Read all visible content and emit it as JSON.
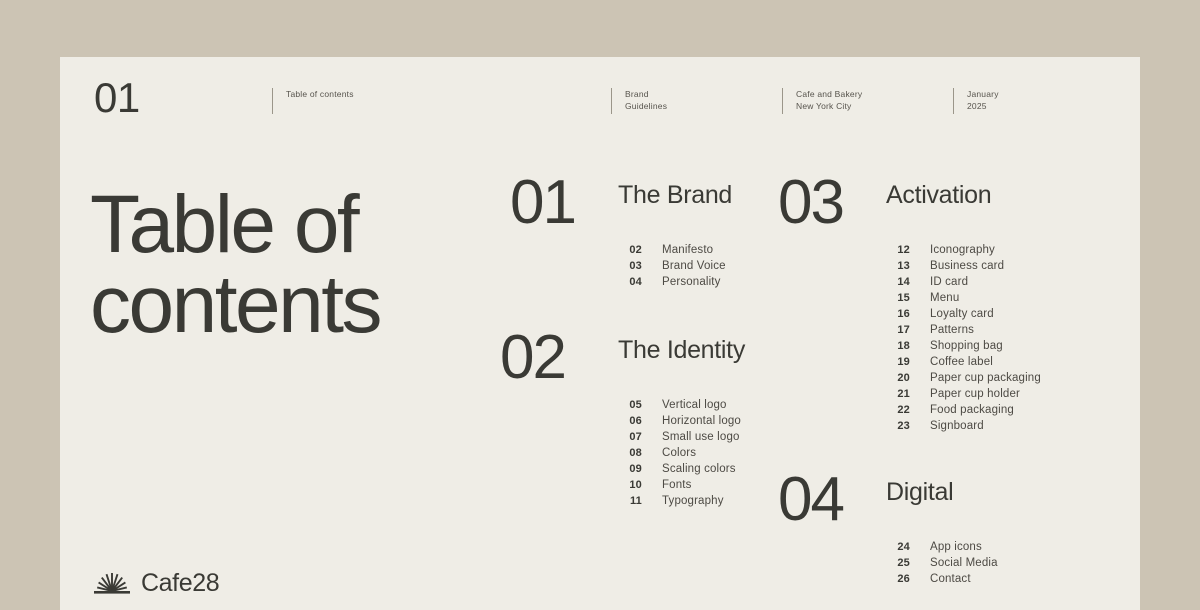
{
  "colors": {
    "outer_background": "#ccc4b4",
    "page_background": "#efede6",
    "ink": "#3a3a35",
    "muted_ink": "#57544d",
    "rule": "#9b968a"
  },
  "header": {
    "page_number": "01",
    "label": "Table of contents",
    "meta": [
      {
        "line1": "Brand",
        "line2": "Guidelines"
      },
      {
        "line1": "Cafe and Bakery",
        "line2": "New York City"
      },
      {
        "line1": "January",
        "line2": "2025"
      }
    ]
  },
  "title": "Table of contents",
  "sections": [
    {
      "number": "01",
      "title": "The Brand",
      "items": [
        {
          "num": "02",
          "label": "Manifesto"
        },
        {
          "num": "03",
          "label": "Brand Voice"
        },
        {
          "num": "04",
          "label": "Personality"
        }
      ]
    },
    {
      "number": "02",
      "title": "The Identity",
      "items": [
        {
          "num": "05",
          "label": "Vertical logo"
        },
        {
          "num": "06",
          "label": "Horizontal logo"
        },
        {
          "num": "07",
          "label": "Small use logo"
        },
        {
          "num": "08",
          "label": "Colors"
        },
        {
          "num": "09",
          "label": "Scaling colors"
        },
        {
          "num": "10",
          "label": "Fonts"
        },
        {
          "num": "11",
          "label": "Typography"
        }
      ]
    },
    {
      "number": "03",
      "title": "Activation",
      "items": [
        {
          "num": "12",
          "label": "Iconography"
        },
        {
          "num": "13",
          "label": "Business card"
        },
        {
          "num": "14",
          "label": "ID card"
        },
        {
          "num": "15",
          "label": "Menu"
        },
        {
          "num": "16",
          "label": "Loyalty card"
        },
        {
          "num": "17",
          "label": "Patterns"
        },
        {
          "num": "18",
          "label": "Shopping bag"
        },
        {
          "num": "19",
          "label": "Coffee label"
        },
        {
          "num": "20",
          "label": "Paper cup packaging"
        },
        {
          "num": "21",
          "label": "Paper cup holder"
        },
        {
          "num": "22",
          "label": "Food packaging"
        },
        {
          "num": "23",
          "label": "Signboard"
        }
      ]
    },
    {
      "number": "04",
      "title": "Digital",
      "items": [
        {
          "num": "24",
          "label": "App icons"
        },
        {
          "num": "25",
          "label": "Social Media"
        },
        {
          "num": "26",
          "label": "Contact"
        }
      ]
    }
  ],
  "footer": {
    "brand_name": "Cafe28",
    "logo_mark": "sunburst-icon"
  }
}
